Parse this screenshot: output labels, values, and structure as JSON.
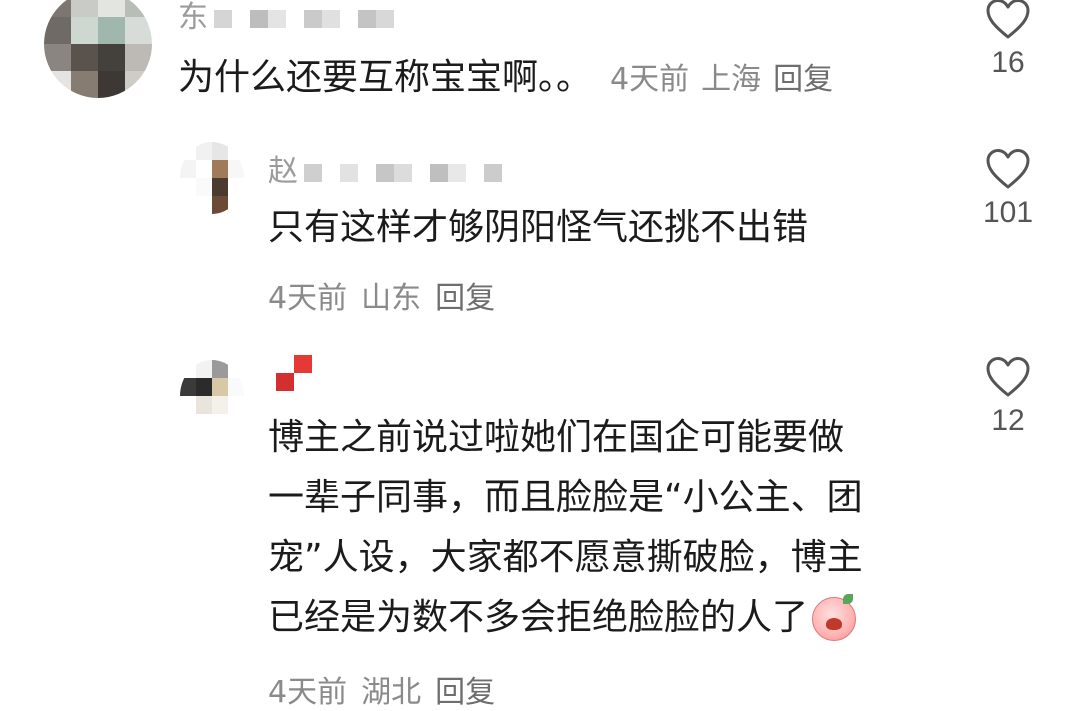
{
  "comments": [
    {
      "username_visible": "东",
      "text": "为什么还要互称宝宝啊。。",
      "time": "4天前",
      "location": "上海",
      "reply": "回复",
      "likes": "16"
    },
    {
      "username_visible": "赵",
      "text": "只有这样才够阴阳怪气还挑不出错",
      "time": "4天前",
      "location": "山东",
      "reply": "回复",
      "likes": "101"
    },
    {
      "username_visible": "",
      "text_lines": [
        "博主之前说过啦她们在国企可能要做",
        "一辈子同事，而且脸脸是“小公主、团",
        "宠”人设，大家都不愿意撕破脸，博主",
        "已经是为数不多会拒绝脸脸的人了"
      ],
      "emoji": "crying-face-emoji",
      "time": "4天前",
      "location": "湖北",
      "reply": "回复",
      "likes": "12"
    }
  ],
  "icons": {
    "like": "heart-outline-icon"
  },
  "colors": {
    "text": "#1b1b1b",
    "meta": "#8a8a8a",
    "icon": "#555555"
  }
}
